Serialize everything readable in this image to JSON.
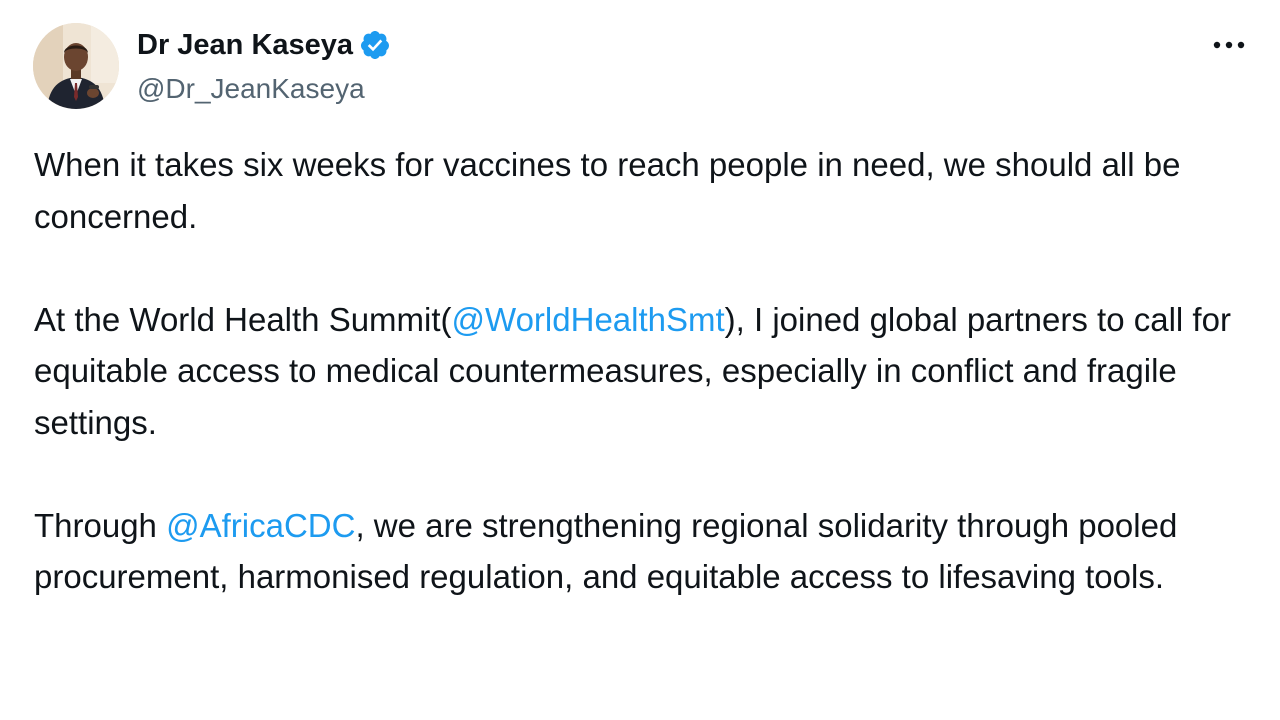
{
  "author": {
    "name": "Dr Jean Kaseya",
    "handle": "@Dr_JeanKaseya",
    "verified": true,
    "avatar_icon": "profile-photo"
  },
  "more_icon": "ellipsis-horizontal-icon",
  "verified_icon": "verified-badge-icon",
  "colors": {
    "text": "#0f1419",
    "secondary": "#536471",
    "link": "#1d9bf0"
  },
  "tweet": {
    "p1": "When it takes six weeks for vaccines to reach people in need, we should all be concerned.",
    "p2_before": "At the World Health Summit(",
    "p2_mention": "@WorldHealthSmt",
    "p2_after": "), I joined global partners to call for equitable access to medical countermeasures, especially in conflict and fragile settings.",
    "p3_before": "Through ",
    "p3_mention": "@AfricaCDC",
    "p3_after": ", we are strengthening regional solidarity through pooled procurement, harmonised regulation, and equitable access to lifesaving tools."
  }
}
